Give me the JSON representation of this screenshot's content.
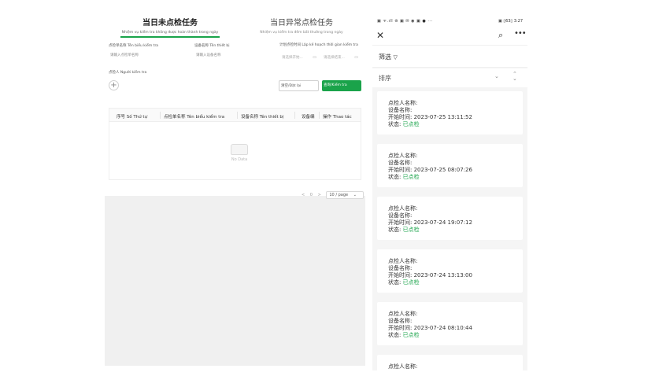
{
  "desktop": {
    "tabs": [
      {
        "title": "当日未点检任务",
        "subtitle": "Nhiệm vụ kiểm tra không được hoàn thành trong ngày"
      },
      {
        "title": "当日异常点检任务",
        "subtitle": "Nhiệm vụ kiểm tra đêm bất thường trong ngày"
      }
    ],
    "fields": {
      "form_name": {
        "label": "点检单名称 Tên biểu kiểm tra",
        "placeholder": "请输入点检单名称"
      },
      "device_name": {
        "label": "设备名称 Tên thiết bị",
        "placeholder": "请输入设备名称"
      },
      "plan_time": {
        "label": "计划点检时间 Lập kế hoạch thời gian kiểm tra",
        "start_placeholder": "请选择开始...",
        "end_placeholder": "请选择结束..."
      },
      "inspector": {
        "label": "点检人 Người kiểm tra"
      }
    },
    "buttons": {
      "reset": "清空/Đặt lại",
      "query": "查询/Kiểm tra"
    },
    "table": {
      "columns": [
        "序号 Số Thứ tự",
        "点检单名称 Tên biểu kiểm tra",
        "设备名称 Tên thiết bị",
        "设备编",
        "操作 Thao tác"
      ],
      "empty_text": "No Data"
    },
    "pager": {
      "prev": "<",
      "page": "0",
      "next": ">",
      "page_size": "10 / page"
    }
  },
  "mobile": {
    "status_left": "▣ ᯤ.ıll ⊜ ▣ ✉ ◉ ▣ ● ···",
    "status_right": "▣ ▯63▯ 3:27",
    "filter_label": "筛选",
    "sort_label": "排序",
    "cards": [
      {
        "inspector_label": "点检人名称:",
        "device_label": "设备名称:",
        "start_label": "开始时间:",
        "start_time": "2023-07-25 13:11:52",
        "status_label": "状态:",
        "status": "已点检"
      },
      {
        "inspector_label": "点检人名称:",
        "device_label": "设备名称:",
        "start_label": "开始时间:",
        "start_time": "2023-07-25 08:07:26",
        "status_label": "状态:",
        "status": "已点检"
      },
      {
        "inspector_label": "点检人名称:",
        "device_label": "设备名称:",
        "start_label": "开始时间:",
        "start_time": "2023-07-24 19:07:12",
        "status_label": "状态:",
        "status": "已点检"
      },
      {
        "inspector_label": "点检人名称:",
        "device_label": "设备名称:",
        "start_label": "开始时间:",
        "start_time": "2023-07-24 13:13:00",
        "status_label": "状态:",
        "status": "已点检"
      },
      {
        "inspector_label": "点检人名称:",
        "device_label": "设备名称:",
        "start_label": "开始时间:",
        "start_time": "2023-07-24 08:10:44",
        "status_label": "状态:",
        "status": "已点检"
      },
      {
        "inspector_label": "点检人名称:"
      }
    ],
    "colors": {
      "accent": "#1aa34a"
    }
  }
}
